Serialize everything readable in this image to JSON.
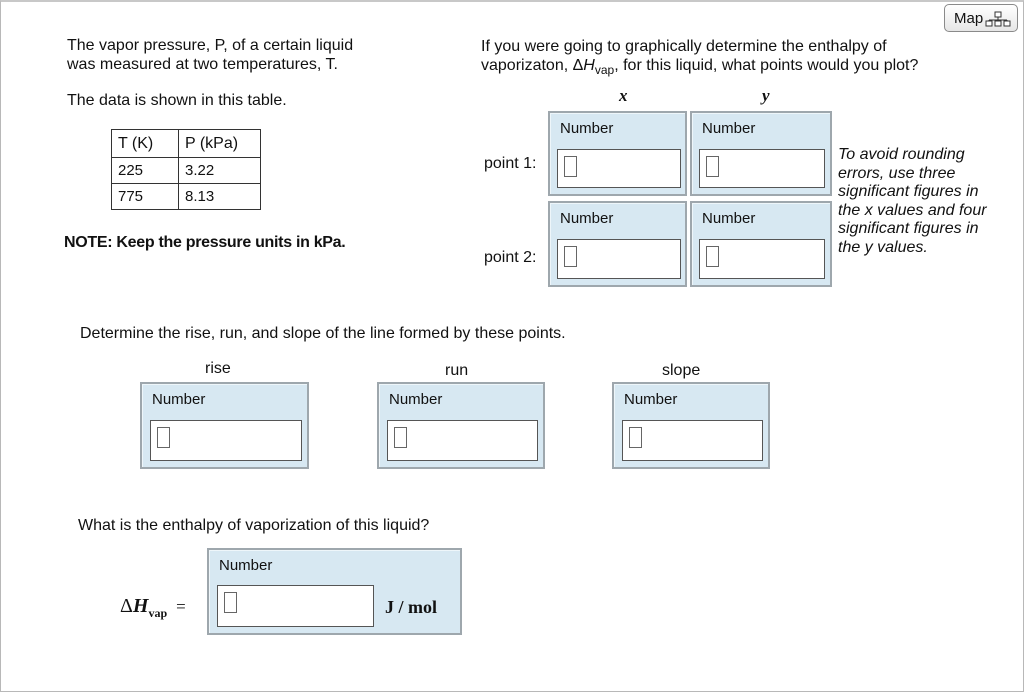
{
  "map_button": {
    "label": "Map"
  },
  "left": {
    "intro_line1": "The vapor pressure, P, of a certain liquid",
    "intro_line2": "was measured at two temperatures, T.",
    "table_intro": "The data is shown in this table.",
    "table": {
      "headers": [
        "T (K)",
        "P (kPa)"
      ],
      "rows": [
        [
          "225",
          "3.22"
        ],
        [
          "775",
          "8.13"
        ]
      ]
    },
    "note": "NOTE: Keep the pressure units in kPa."
  },
  "plot": {
    "question_line1": "If you were going to graphically determine the enthalpy of",
    "question_line2_pre": "vaporizaton, Δ",
    "question_H": "H",
    "question_sub": "vap",
    "question_line2_post": ", for this liquid, what points would you plot?",
    "x_header": "x",
    "y_header": "y",
    "point1_label": "point 1:",
    "point2_label": "point 2:",
    "field_label": "Number",
    "hint": [
      "To avoid rounding",
      "errors, use three",
      "significant figures in",
      "the x values and four",
      "significant figures in",
      "the y values."
    ]
  },
  "slope_section": {
    "prompt": "Determine the rise, run, and slope of the line formed by these points.",
    "rise_label": "rise",
    "run_label": "run",
    "slope_label": "slope",
    "field_label": "Number"
  },
  "enthalpy_section": {
    "prompt": "What is the enthalpy of vaporization of this liquid?",
    "field_label": "Number",
    "symbol_delta": "Δ",
    "symbol_H": "H",
    "symbol_sub": "vap",
    "equals": "=",
    "unit": "J / mol"
  }
}
